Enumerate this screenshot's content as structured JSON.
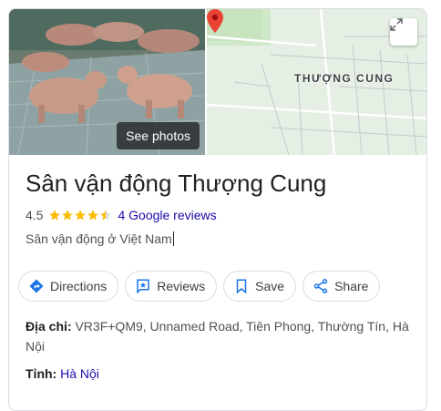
{
  "photo": {
    "button_label": "See photos"
  },
  "map": {
    "label": "THƯỢNG CUNG"
  },
  "place": {
    "name": "Sân vận động Thượng Cung",
    "rating": "4.5",
    "rating_value": 4.5,
    "reviews_text": "4 Google reviews",
    "category": "Sân vận động ở Việt Nam"
  },
  "actions": [
    {
      "label": "Directions",
      "icon": "directions-icon"
    },
    {
      "label": "Reviews",
      "icon": "reviews-icon"
    },
    {
      "label": "Save",
      "icon": "bookmark-icon"
    },
    {
      "label": "Share",
      "icon": "share-icon"
    }
  ],
  "address": {
    "label": "Địa chỉ:",
    "line1": "VR3F+QM9, Unnamed Road, Tiên Phong, Thường Tín, Hà",
    "line2": "Nội"
  },
  "province": {
    "label": "Tỉnh:",
    "value": "Hà Nội"
  },
  "colors": {
    "star": "#fbbc04",
    "link": "#1a0dab",
    "pin": "#ea4335",
    "accent": "#1a73e8"
  }
}
